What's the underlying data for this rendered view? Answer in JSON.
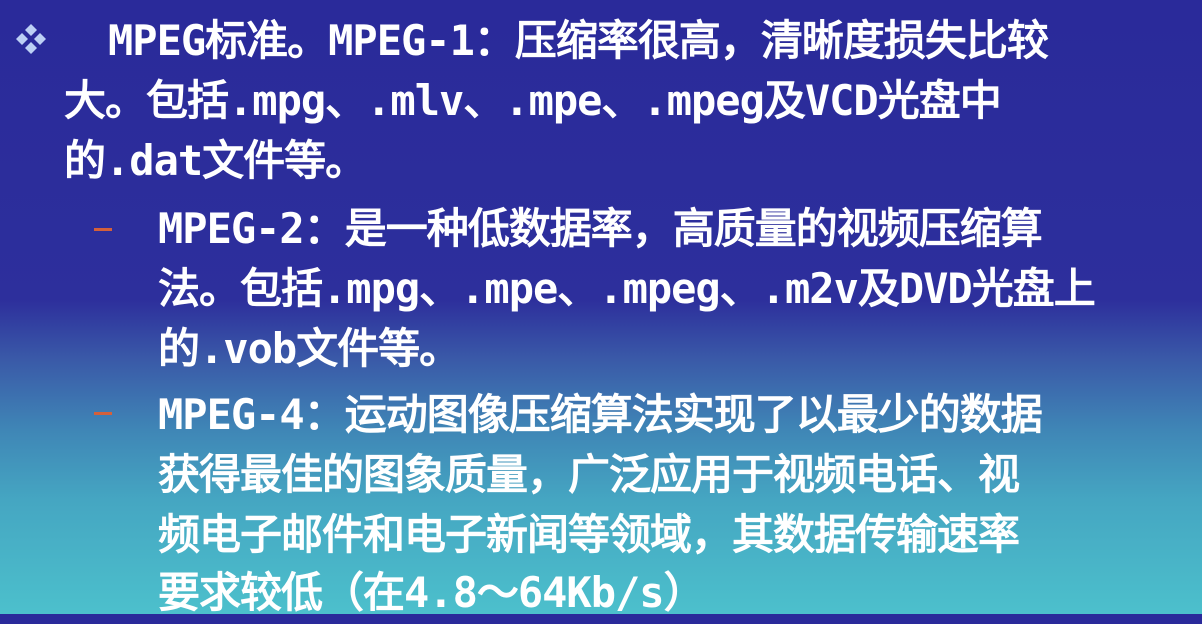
{
  "colors": {
    "background_top": "#2a2a9a",
    "background_bottom": "#4cc0cc",
    "text": "#ffffff",
    "bullet_diamond": "#bcd0f5",
    "dash": "#d4603a"
  },
  "icons": {
    "main_bullet": "four-diamond-bullet-icon",
    "sub_bullet": "dash-bullet-icon"
  },
  "main_point": {
    "lines": [
      "MPEG标准。MPEG-1：压缩率很高，清晰度损失比较",
      "大。包括.mpg、.mlv、.mpe、.mpeg及VCD光盘中",
      "的.dat文件等。"
    ]
  },
  "sub_points": [
    {
      "lines": [
        "MPEG-2：是一种低数据率，高质量的视频压缩算",
        "法。包括.mpg、.mpe、.mpeg、.m2v及DVD光盘上",
        "的.vob文件等。"
      ]
    },
    {
      "lines": [
        "MPEG-4：运动图像压缩算法实现了以最少的数据",
        "获得最佳的图象质量，广泛应用于视频电话、视",
        "频电子邮件和电子新闻等领域，其数据传输速率",
        "要求较低（在4.8～64Kb/s）"
      ]
    }
  ]
}
